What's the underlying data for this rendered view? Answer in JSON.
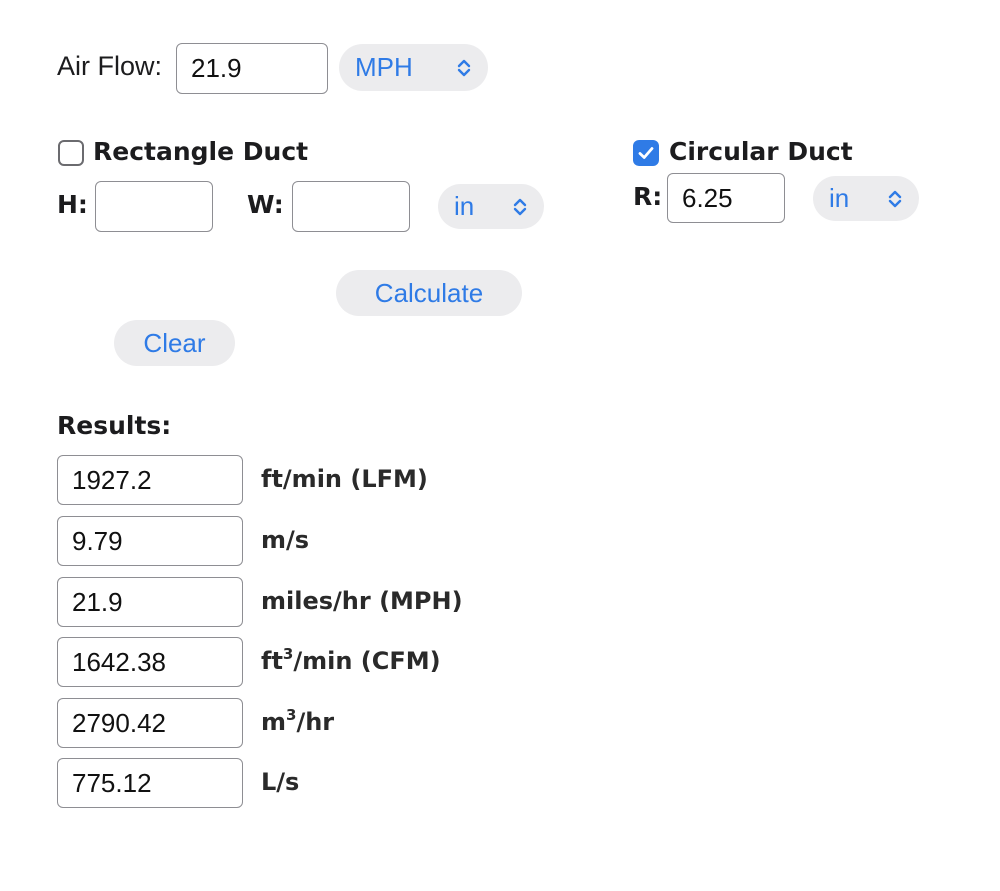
{
  "airflow": {
    "label": "Air Flow:",
    "value": "21.9",
    "unit": "MPH"
  },
  "rectangle": {
    "label": "Rectangle Duct",
    "checked": false,
    "h_label": "H:",
    "h_value": "",
    "w_label": "W:",
    "w_value": "",
    "unit": "in"
  },
  "circular": {
    "label": "Circular Duct",
    "checked": true,
    "r_label": "R:",
    "r_value": "6.25",
    "unit": "in"
  },
  "actions": {
    "calculate": "Calculate",
    "clear": "Clear"
  },
  "results": {
    "label": "Results:",
    "rows": [
      {
        "value": "1927.2",
        "unit": "ft/min (LFM)"
      },
      {
        "value": "9.79",
        "unit": "m/s"
      },
      {
        "value": "21.9",
        "unit": "miles/hr (MPH)"
      },
      {
        "value": "1642.38",
        "unit_pre": "ft",
        "unit_sup": "3",
        "unit_post": "/min (CFM)"
      },
      {
        "value": "2790.42",
        "unit_pre": "m",
        "unit_sup": "3",
        "unit_post": "/hr"
      },
      {
        "value": "775.12",
        "unit": "L/s"
      }
    ]
  },
  "colors": {
    "accent": "#2f7be6",
    "control_bg": "#ececee",
    "border": "#8e8e93"
  },
  "icons": {
    "select_arrow": "chevron-up-down-icon",
    "checkmark": "checkmark-icon"
  }
}
